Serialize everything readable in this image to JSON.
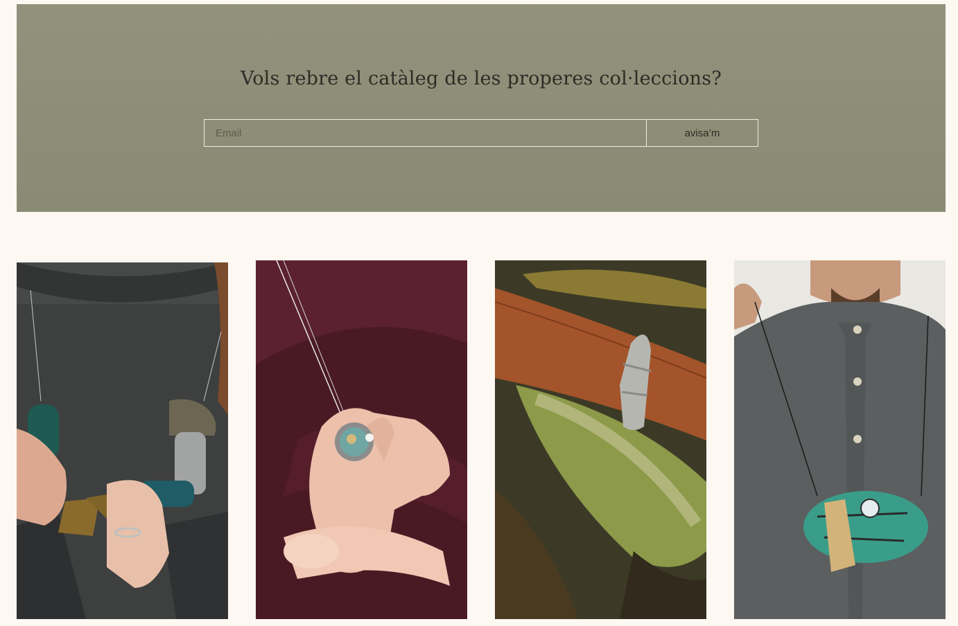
{
  "newsletter": {
    "title": "Vols rebre el catàleg de les properes col·leccions?",
    "email_placeholder": "Email",
    "submit_label": "avisa’m",
    "background_color": "#8e8f78"
  },
  "gallery": {
    "photos": [
      {
        "subject": "necklace-with-geometric-pendants-on-dark-sweater"
      },
      {
        "subject": "round-pendant-held-in-hand-on-burgundy-knit"
      },
      {
        "subject": "twig-silver-ring-on-autumn-leaves"
      },
      {
        "subject": "turquoise-oval-pendant-on-grey-shirt"
      }
    ]
  },
  "colors": {
    "page_background": "#fdf8f2",
    "text": "#2e2b26",
    "form_border": "#f1ede4"
  }
}
